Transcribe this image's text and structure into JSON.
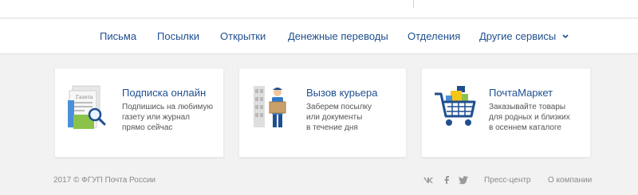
{
  "nav": {
    "items": [
      {
        "label": "Письма"
      },
      {
        "label": "Посылки"
      },
      {
        "label": "Открытки"
      },
      {
        "label": "Денежные переводы"
      },
      {
        "label": "Отделения"
      },
      {
        "label": "Другие сервисы"
      }
    ],
    "dropdown_icon": "chevron-down-icon"
  },
  "cards": [
    {
      "icon": "newspaper-magnifier-icon",
      "newspaper_text": "Газета",
      "title": "Подписка онлайн",
      "desc": [
        "Подпишись на любимую",
        "газету или журнал",
        "прямо сейчас"
      ]
    },
    {
      "icon": "courier-icon",
      "title": "Вызов курьера",
      "desc": [
        "Заберем посылку",
        "или документы",
        "в течение дня"
      ]
    },
    {
      "icon": "shopping-cart-icon",
      "title": "ПочтаМаркет",
      "desc": [
        "Заказывайте товары",
        "для родных и близких",
        "в осеннем каталоге"
      ]
    }
  ],
  "footer": {
    "copyright": "2017 © ФГУП Почта России",
    "social": [
      "vk-icon",
      "facebook-icon",
      "twitter-icon"
    ],
    "links": [
      {
        "label": "Пресс-центр"
      },
      {
        "label": "О компании"
      }
    ]
  },
  "colors": {
    "accent": "#1f4f8f",
    "background": "#f2f2f2",
    "card_bg": "#ffffff",
    "muted_text": "#8a8a8a"
  }
}
